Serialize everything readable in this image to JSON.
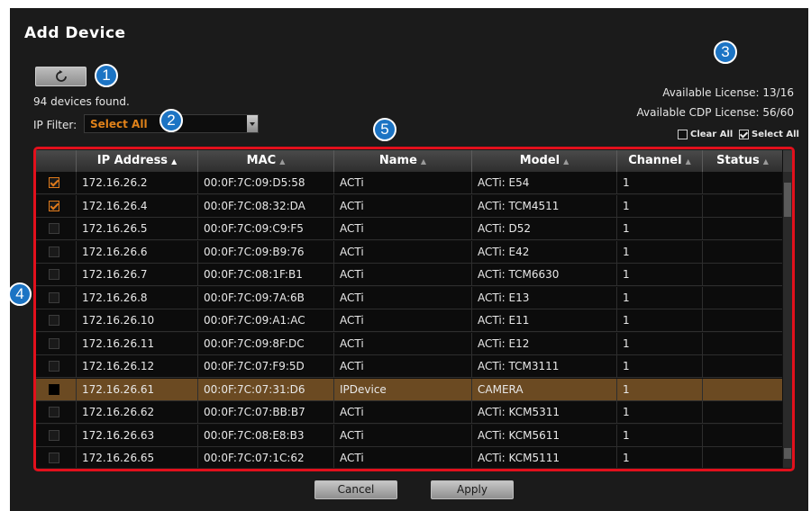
{
  "dialog": {
    "title": "Add Device",
    "devices_found": "94 devices found.",
    "ip_filter_label": "IP Filter:",
    "ip_filter_value": "Select All",
    "available_license": "Available License: 13/16",
    "available_cdp_license": "Available CDP License: 56/60",
    "clear_all_label": "Clear All",
    "select_all_label": "Select All",
    "cancel_label": "Cancel",
    "apply_label": "Apply"
  },
  "table": {
    "columns": [
      "IP Address",
      "MAC",
      "Name",
      "Model",
      "Channel",
      "Status"
    ],
    "rows": [
      {
        "checked": true,
        "ip": "172.16.26.2",
        "mac": "00:0F:7C:09:D5:58",
        "name": "ACTi",
        "model": "ACTi: E54",
        "channel": "1"
      },
      {
        "checked": true,
        "ip": "172.16.26.4",
        "mac": "00:0F:7C:08:32:DA",
        "name": "ACTi",
        "model": "ACTi: TCM4511",
        "channel": "1"
      },
      {
        "checked": false,
        "ip": "172.16.26.5",
        "mac": "00:0F:7C:09:C9:F5",
        "name": "ACTi",
        "model": "ACTi: D52",
        "channel": "1"
      },
      {
        "checked": false,
        "ip": "172.16.26.6",
        "mac": "00:0F:7C:09:B9:76",
        "name": "ACTi",
        "model": "ACTi: E42",
        "channel": "1"
      },
      {
        "checked": false,
        "ip": "172.16.26.7",
        "mac": "00:0F:7C:08:1F:B1",
        "name": "ACTi",
        "model": "ACTi: TCM6630",
        "channel": "1"
      },
      {
        "checked": false,
        "ip": "172.16.26.8",
        "mac": "00:0F:7C:09:7A:6B",
        "name": "ACTi",
        "model": "ACTi: E13",
        "channel": "1"
      },
      {
        "checked": false,
        "ip": "172.16.26.10",
        "mac": "00:0F:7C:09:A1:AC",
        "name": "ACTi",
        "model": "ACTi: E11",
        "channel": "1"
      },
      {
        "checked": false,
        "ip": "172.16.26.11",
        "mac": "00:0F:7C:09:8F:DC",
        "name": "ACTi",
        "model": "ACTi: E12",
        "channel": "1"
      },
      {
        "checked": false,
        "ip": "172.16.26.12",
        "mac": "00:0F:7C:07:F9:5D",
        "name": "ACTi",
        "model": "ACTi: TCM3111",
        "channel": "1"
      },
      {
        "checked": false,
        "selected": true,
        "ip": "172.16.26.61",
        "mac": "00:0F:7C:07:31:D6",
        "name": "IPDevice",
        "model": "CAMERA",
        "channel": "1"
      },
      {
        "checked": false,
        "ip": "172.16.26.62",
        "mac": "00:0F:7C:07:BB:B7",
        "name": "ACTi",
        "model": "ACTi: KCM5311",
        "channel": "1"
      },
      {
        "checked": false,
        "ip": "172.16.26.63",
        "mac": "00:0F:7C:08:E8:B3",
        "name": "ACTi",
        "model": "ACTi: KCM5611",
        "channel": "1"
      },
      {
        "checked": false,
        "ip": "172.16.26.65",
        "mac": "00:0F:7C:07:1C:62",
        "name": "ACTi",
        "model": "ACTi: KCM5111",
        "channel": "1"
      }
    ]
  },
  "callouts": [
    "1",
    "2",
    "3",
    "4",
    "5"
  ],
  "colors": {
    "accent_orange": "#e0821a",
    "selected_row": "#6b4a22",
    "callout_blue": "#1c74c4",
    "highlight_red": "#e2101c"
  },
  "icons": {
    "refresh": "refresh-icon",
    "dropdown": "chevron-down-icon"
  }
}
